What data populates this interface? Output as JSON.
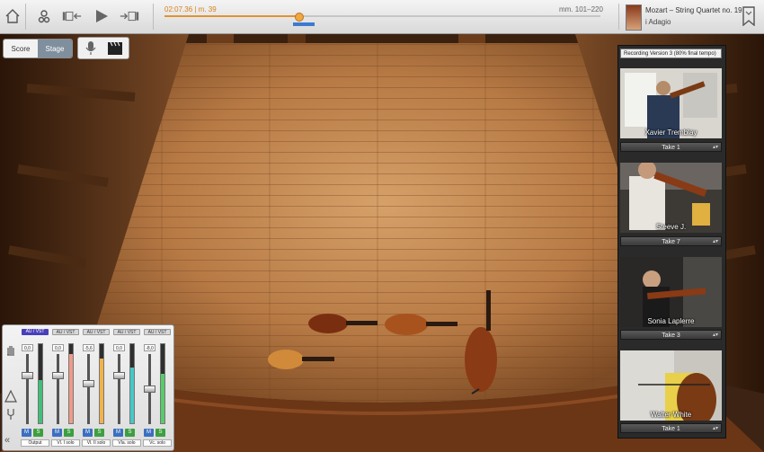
{
  "transport": {
    "timecode": "02:07.36 | m. 39",
    "measure_range": "mm. 101–220",
    "progress": 0.31
  },
  "piece": {
    "title": "Mozart – String Quartet no. 19",
    "movement": "i Adagio"
  },
  "view": {
    "score_label": "Score",
    "stage_label": "Stage"
  },
  "recording": {
    "version_label": "Recording Version 3 (80% final tempo)"
  },
  "performers": [
    {
      "name": "Xavier Tremblay",
      "take": "Take 1"
    },
    {
      "name": "Steeve J.",
      "take": "Take 7"
    },
    {
      "name": "Sonia Laplerre",
      "take": "Take 3"
    },
    {
      "name": "Walter White",
      "take": "Take 1"
    }
  ],
  "mixer": {
    "strips": [
      {
        "plugin": "AU / VST",
        "gain": "0,0",
        "label": "Output",
        "level": 0.55,
        "fader": 0.72,
        "meter_color": "#3fbf7a"
      },
      {
        "plugin": "AU / VST",
        "gain": "0,0",
        "label": "Vl. I solo",
        "level": 0.88,
        "fader": 0.72,
        "meter_color": "#f09a8a"
      },
      {
        "plugin": "AU / VST",
        "gain": "-5,6",
        "label": "Vl. II solo",
        "level": 0.82,
        "fader": 0.58,
        "meter_color": "#f2b24a"
      },
      {
        "plugin": "AU / VST",
        "gain": "0,0",
        "label": "Vla. solo",
        "level": 0.7,
        "fader": 0.72,
        "meter_color": "#45c8c8"
      },
      {
        "plugin": "AU / VST",
        "gain": "-8,0",
        "label": "Vc. solo",
        "level": 0.62,
        "fader": 0.5,
        "meter_color": "#58cc6a"
      }
    ],
    "mute_label": "M",
    "solo_label": "S"
  },
  "colors": {
    "accent_orange": "#e1932c",
    "loop_blue": "#3c7bd0",
    "plugin_purple": "#4a3fbb",
    "mute_blue": "#3b6fc0",
    "solo_green": "#3d9f40"
  }
}
